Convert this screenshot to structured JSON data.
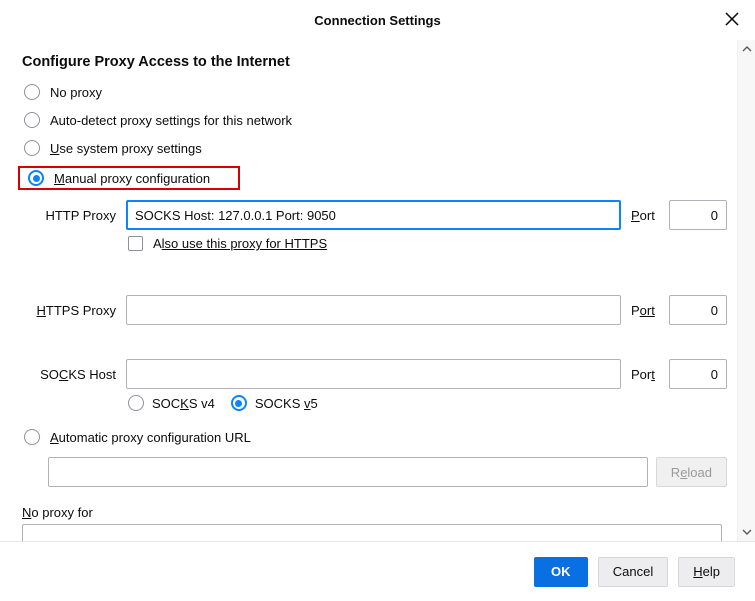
{
  "title": "Connection Settings",
  "heading": "Configure Proxy Access to the Internet",
  "options": {
    "no_proxy": "No proxy",
    "auto_detect": "Auto-detect proxy settings for this network",
    "system": "se system proxy settings",
    "manual": "anual proxy configuration",
    "auto_url": "utomatic proxy configuration URL"
  },
  "fields": {
    "http_label": "HTTP Proxy",
    "http_value": "SOCKS Host: 127.0.0.1 Port: 9050",
    "also_https": "lso use this proxy for HTTPS",
    "https_prefix": "H",
    "https_rest": "TTPS Proxy",
    "socks_prefix": "SO",
    "socks_rest": "KS Host",
    "socks_v4": "S v4",
    "socks_v5": "5",
    "port_label": "ort",
    "port0": "0"
  },
  "pac": {
    "reload": "Reload"
  },
  "noproxy": {
    "label": "o proxy for"
  },
  "footer": {
    "ok": "OK",
    "cancel": "Cancel",
    "help": "elp"
  }
}
